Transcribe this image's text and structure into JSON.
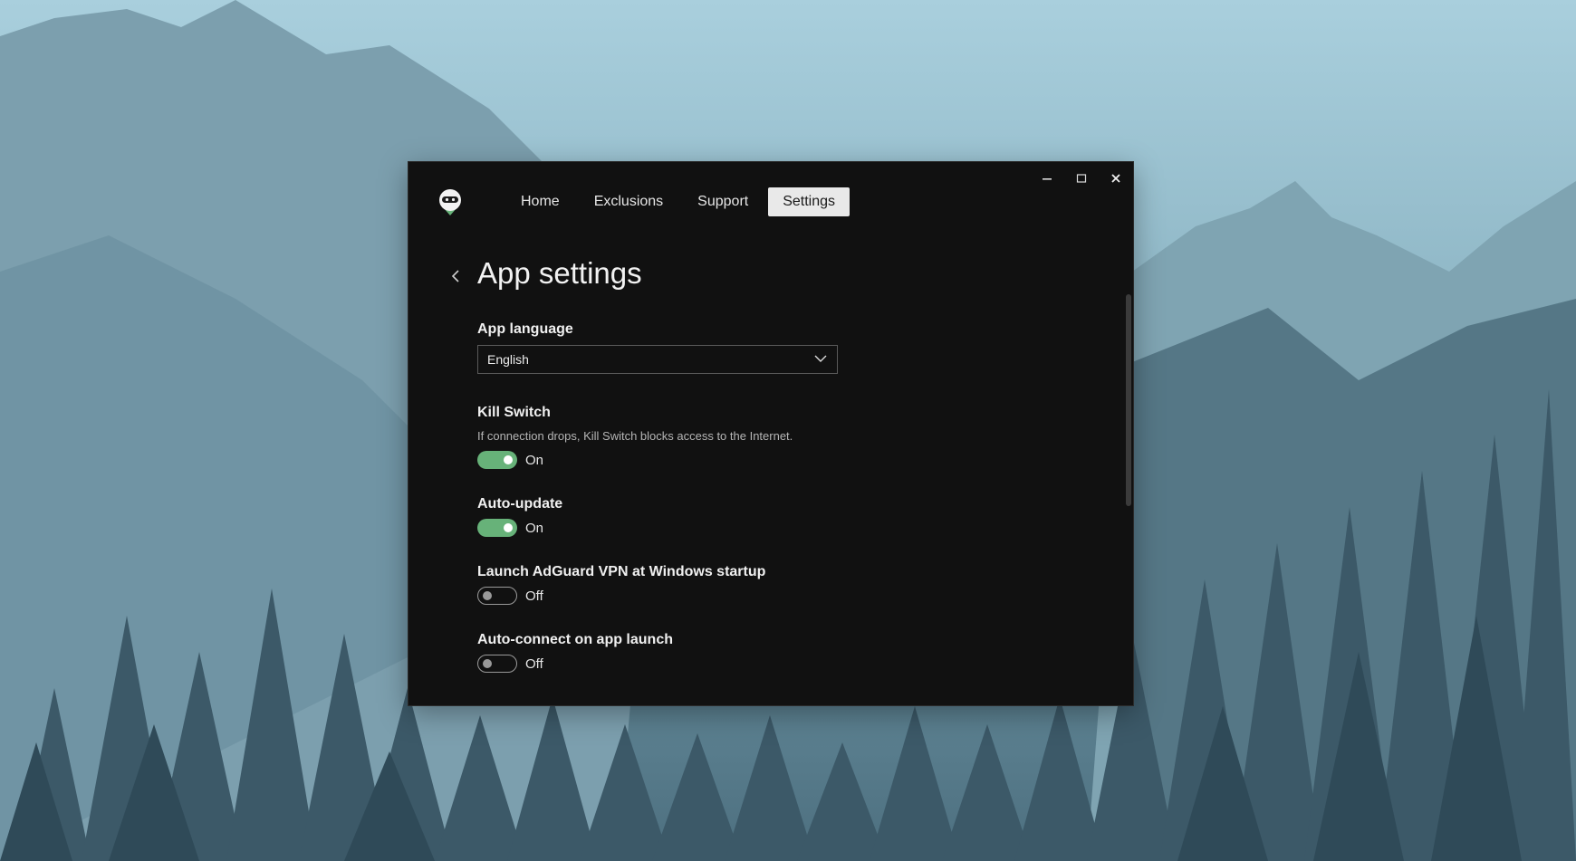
{
  "window": {
    "controls": {
      "minimize": "—",
      "maximize": "☐",
      "close": "✕"
    }
  },
  "nav": {
    "tabs": [
      {
        "label": "Home"
      },
      {
        "label": "Exclusions"
      },
      {
        "label": "Support"
      },
      {
        "label": "Settings",
        "active": true
      }
    ]
  },
  "page": {
    "title": "App settings"
  },
  "settings": {
    "language": {
      "label": "App language",
      "value": "English"
    },
    "kill_switch": {
      "label": "Kill Switch",
      "description": "If connection drops, Kill Switch blocks access to the Internet.",
      "state": "On"
    },
    "auto_update": {
      "label": "Auto-update",
      "state": "On"
    },
    "launch_startup": {
      "label": "Launch AdGuard VPN at Windows startup",
      "state": "Off"
    },
    "auto_connect": {
      "label": "Auto-connect on app launch",
      "state": "Off"
    }
  },
  "colors": {
    "accent": "#67b279",
    "window_bg": "#111111",
    "active_tab_bg": "#e9e9e9"
  },
  "icons": [
    "logo-icon",
    "back-arrow-icon",
    "chevron-down-icon",
    "minimize-icon",
    "maximize-icon",
    "close-icon"
  ]
}
